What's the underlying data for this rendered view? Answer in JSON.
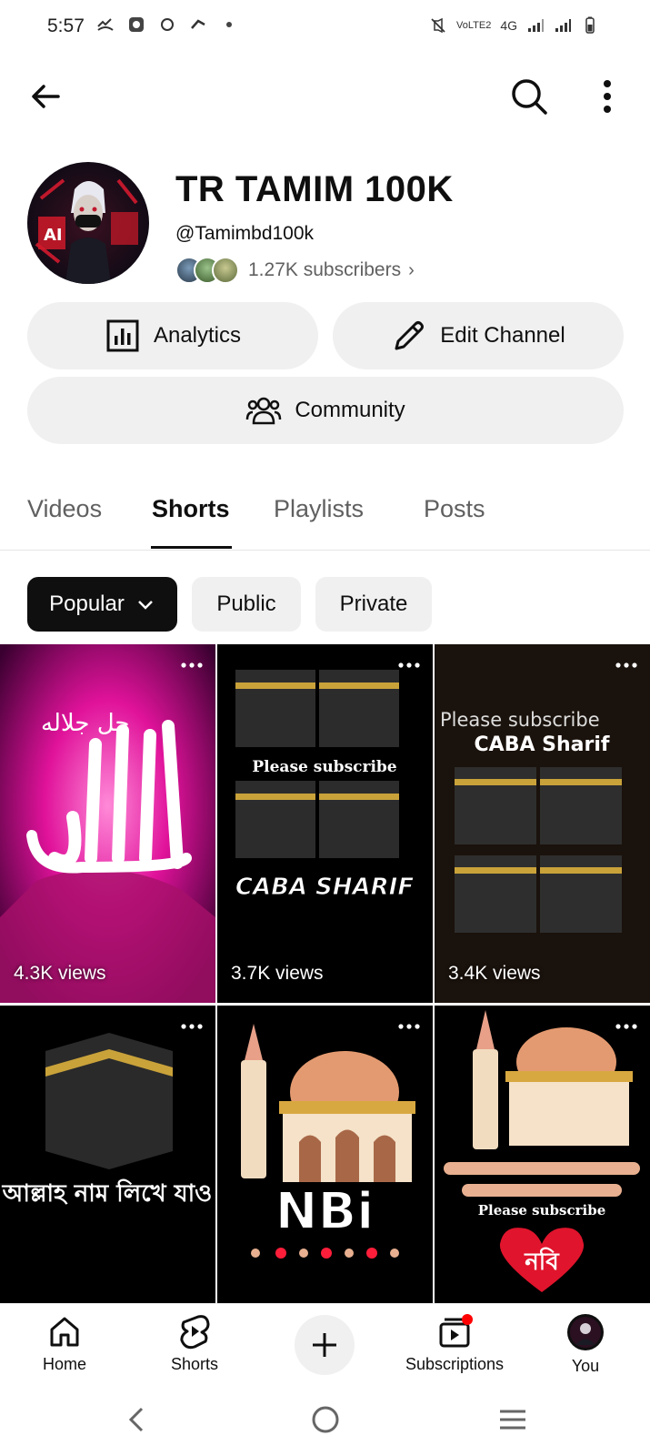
{
  "status_bar": {
    "time": "5:57",
    "network_label": "4G",
    "volte_label": "VoLTE2"
  },
  "channel": {
    "title": "TR TAMIM 100K",
    "handle": "@Tamimbd100k",
    "subscribers": "1.27K subscribers"
  },
  "actions": {
    "analytics_label": "Analytics",
    "edit_label": "Edit Channel",
    "community_label": "Community"
  },
  "tabs": [
    {
      "label": "Videos",
      "active": false
    },
    {
      "label": "Shorts",
      "active": true
    },
    {
      "label": "Playlists",
      "active": false
    },
    {
      "label": "Posts",
      "active": false
    }
  ],
  "filters": [
    {
      "label": "Popular",
      "active": true
    },
    {
      "label": "Public",
      "active": false
    },
    {
      "label": "Private",
      "active": false
    }
  ],
  "shorts": [
    {
      "views": "4.3K views",
      "art_text": "",
      "icon": "allah-calligraphy"
    },
    {
      "views": "3.7K views",
      "art_text": "CABA SHARIF",
      "caption": "Please subscribe",
      "icon": "kaaba"
    },
    {
      "views": "3.4K views",
      "art_text": "CABA Sharif",
      "caption": "Please subscribe",
      "icon": "kaaba"
    },
    {
      "views": "",
      "art_text": "আল্লাহ নাম লিখে যাও",
      "icon": "kaaba"
    },
    {
      "views": "",
      "art_text": "NBi",
      "icon": "mosque"
    },
    {
      "views": "",
      "art_text": "নবি",
      "caption": "Please subscribe",
      "icon": "mosque"
    }
  ],
  "bottom_nav": {
    "home": "Home",
    "shorts": "Shorts",
    "subscriptions": "Subscriptions",
    "you": "You"
  },
  "colors": {
    "accent": "#0f0f0f",
    "chip_bg": "#f0f0f0",
    "secondary_text": "#606060",
    "notification_dot": "#ff0000"
  }
}
